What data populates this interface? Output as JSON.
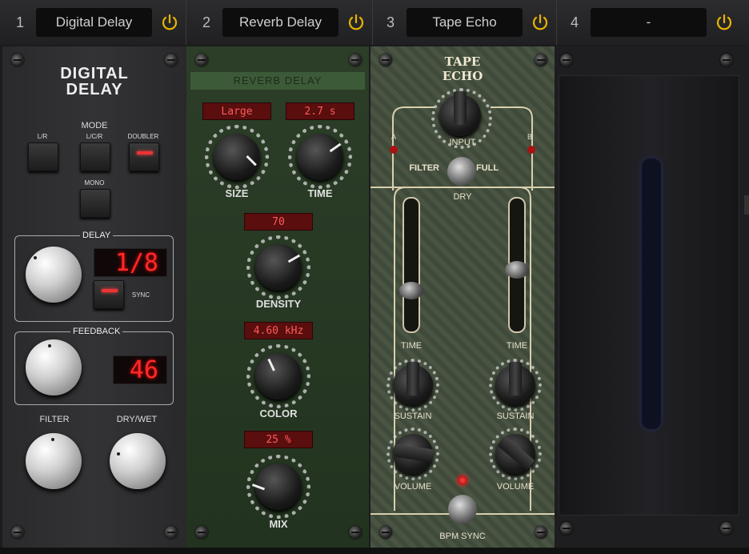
{
  "slots": [
    {
      "num": "1",
      "name": "Digital Delay"
    },
    {
      "num": "2",
      "name": "Reverb Delay"
    },
    {
      "num": "3",
      "name": "Tape Echo"
    },
    {
      "num": "4",
      "name": "-"
    }
  ],
  "accent": "#e8b400",
  "digital_delay": {
    "title_line1": "DIGITAL",
    "title_line2": "DELAY",
    "mode_label": "MODE",
    "modes": [
      "L/R",
      "L/C/R",
      "DOUBLER",
      "MONO"
    ],
    "delay_label": "DELAY",
    "delay_value": "1/8",
    "sync_label": "SYNC",
    "feedback_label": "FEEDBACK",
    "feedback_value": "46",
    "filter_label": "FILTER",
    "drywet_label": "DRY/WET"
  },
  "reverb_delay": {
    "header": "REVERB DELAY",
    "size_value": "Large",
    "size_label": "SIZE",
    "time_value": "2.7 s",
    "time_label": "TIME",
    "density_value": "70",
    "density_label": "DENSITY",
    "color_value": "4.60 kHz",
    "color_label": "COLOR",
    "mix_value": "25 %",
    "mix_label": "MIX"
  },
  "tape_echo": {
    "logo": "TAPE ECHO",
    "input_label": "INPUT",
    "a_label": "A",
    "b_label": "B",
    "filter_label": "FILTER",
    "full_label": "FULL",
    "dry_label": "DRY",
    "time_left_label": "TIME",
    "time_right_label": "TIME",
    "sustain_left_label": "SUSTAIN",
    "sustain_right_label": "SUSTAIN",
    "volume_left_label": "VOLUME",
    "volume_right_label": "VOLUME",
    "bpm_sync_label": "BPM SYNC"
  }
}
